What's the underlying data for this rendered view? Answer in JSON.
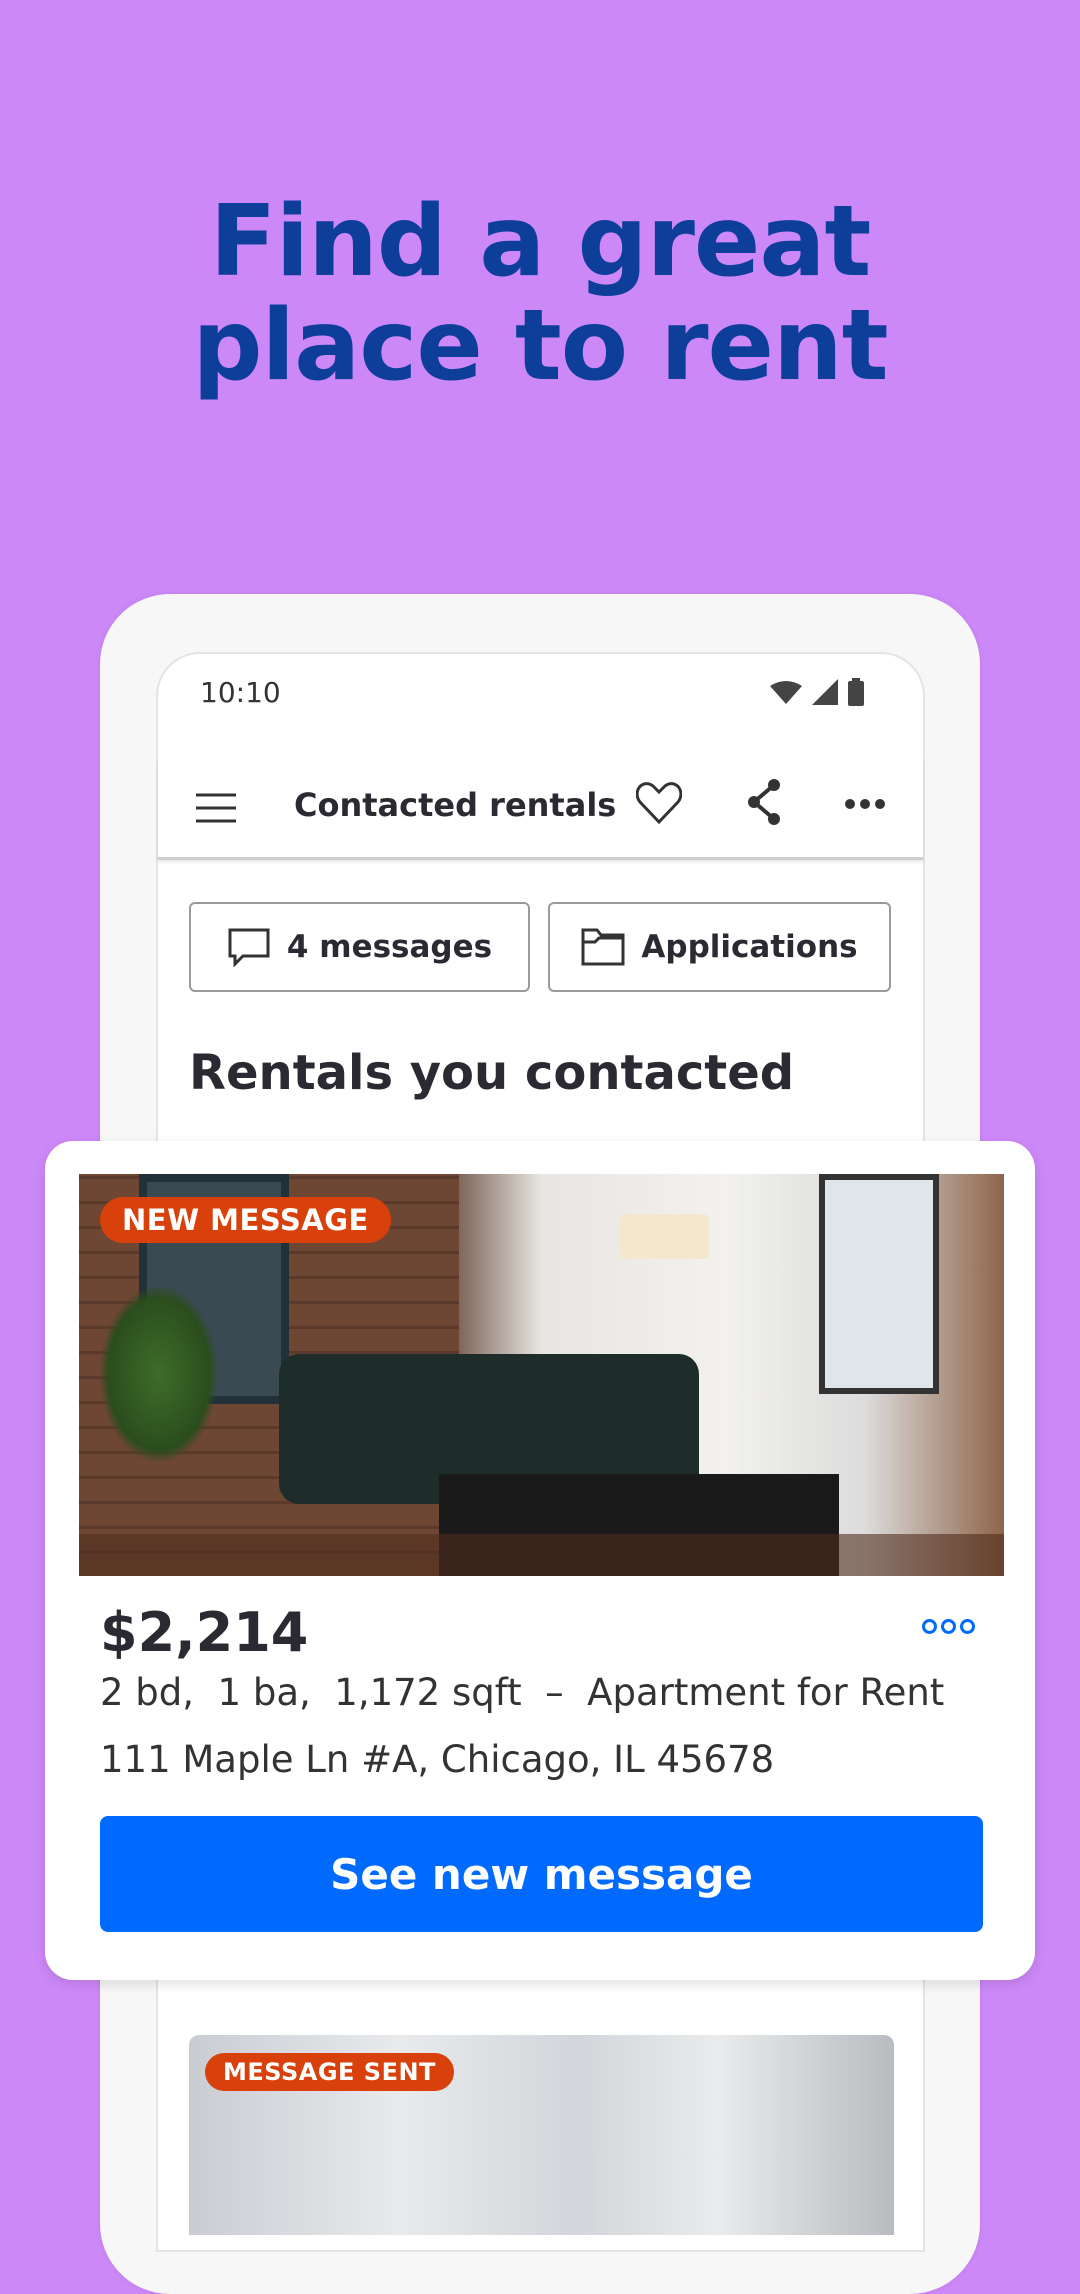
{
  "headline": {
    "line1": "Find a great",
    "line2": "place to rent"
  },
  "status_bar": {
    "time": "10:10",
    "icons": [
      "wifi-icon",
      "signal-icon",
      "battery-icon"
    ]
  },
  "toolbar": {
    "title": "Contacted rentals",
    "icons": [
      "menu-icon",
      "heart-icon",
      "share-icon",
      "more-icon"
    ]
  },
  "filters": [
    {
      "label": "4 messages",
      "icon": "chat-icon"
    },
    {
      "label": "Applications",
      "icon": "folder-icon"
    }
  ],
  "section_title": "Rentals you contacted",
  "listings": [
    {
      "badge": "NEW MESSAGE",
      "price": "$2,214",
      "details": "2 bd,  1 ba,  1,172 sqft  –  Apartment for Rent",
      "address": "111 Maple Ln #A, Chicago, IL 45678",
      "cta": "See new message"
    },
    {
      "badge": "MESSAGE SENT"
    }
  ],
  "colors": {
    "background": "#cd88f8",
    "headline": "#0d3e9a",
    "primary": "#006aff",
    "badge": "#d8410b"
  }
}
